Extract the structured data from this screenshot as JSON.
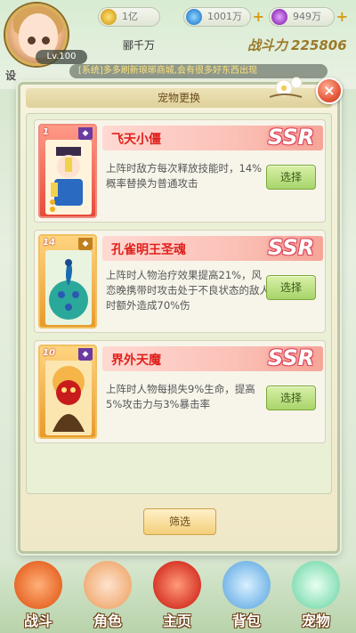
{
  "hud": {
    "level": "Lv.100",
    "gold": "1亿",
    "gems": "1001万",
    "orbs": "949万",
    "player_name": "郦千万",
    "power_label": "战斗力",
    "power_value": "225806",
    "side_label": "设",
    "marquee": "[系统]多多刷新琅琊商城,会有很多好东西出现"
  },
  "modal": {
    "title": "宠物更换",
    "close_glyph": "×",
    "filter_label": "筛选"
  },
  "pets": [
    {
      "name": "飞天小僵",
      "rarity": "SSR",
      "card_level": "1",
      "card_badge": "◆",
      "description": "上阵时敌方每次释放技能时，14%概率替换为普通攻击",
      "select_label": "选择"
    },
    {
      "name": "孔雀明王圣魂",
      "rarity": "SSR",
      "card_level": "14",
      "card_badge": "◆",
      "description": "上阵时人物治疗效果提高21%，风恋晚携带时攻击处于不良状态的敌人时额外造成70%伤",
      "select_label": "选择"
    },
    {
      "name": "界外天魔",
      "rarity": "SSR",
      "card_level": "10",
      "card_badge": "◆",
      "description": "上阵时人物每损失9%生命，提高5%攻击力与3%暴击率",
      "select_label": "选择"
    }
  ],
  "nav": [
    {
      "label": "战斗",
      "icon": "sword-icon"
    },
    {
      "label": "角色",
      "icon": "character-icon"
    },
    {
      "label": "主页",
      "icon": "pagoda-icon"
    },
    {
      "label": "背包",
      "icon": "bag-icon"
    },
    {
      "label": "宠物",
      "icon": "pet-icon"
    }
  ],
  "colors": {
    "accent_red": "#e0201c",
    "button_green": "#a8d46a",
    "filter_gold": "#f3cf7a",
    "card_red": "#e64a3a"
  }
}
